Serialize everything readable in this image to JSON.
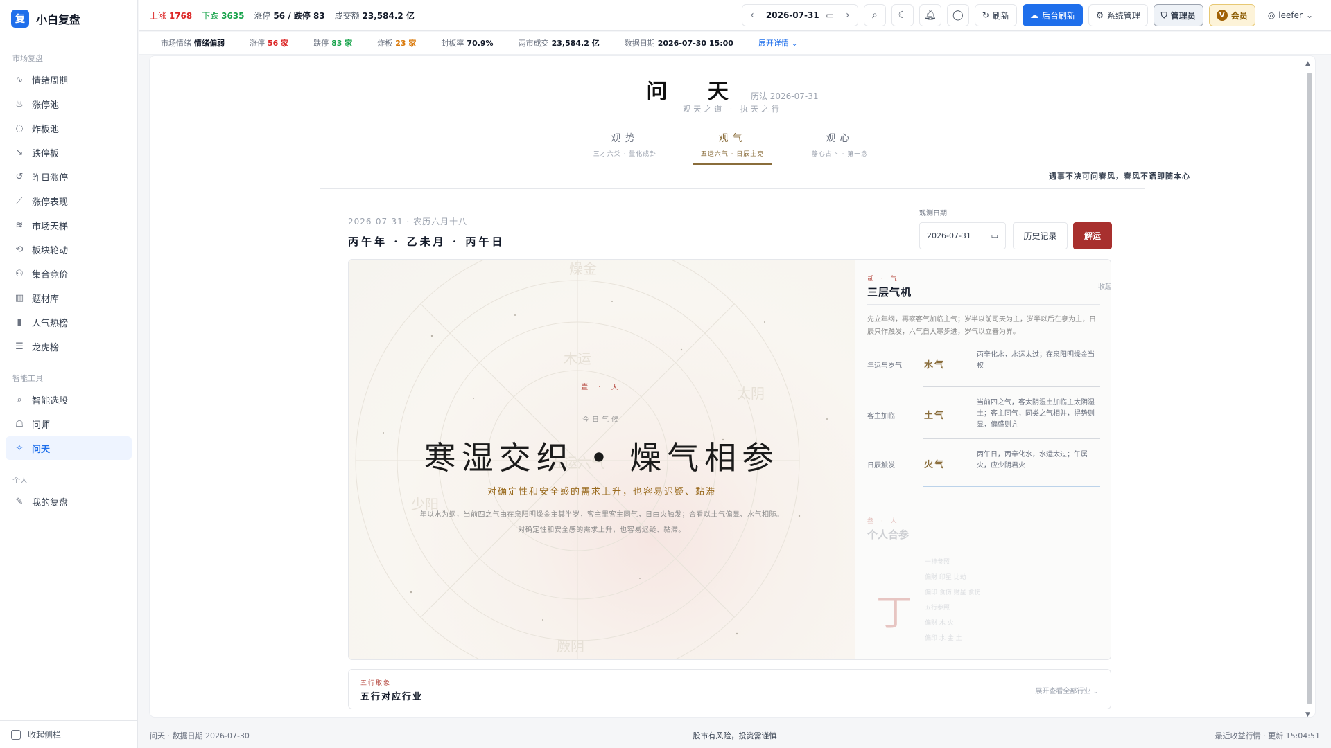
{
  "app": {
    "logo_char": "复",
    "name": "小白复盘"
  },
  "sidebar": {
    "groups": [
      {
        "label": "市场复盘",
        "items": [
          {
            "label": "情绪周期",
            "icon": "pulse-icon"
          },
          {
            "label": "涨停池",
            "icon": "flame-icon"
          },
          {
            "label": "炸板池",
            "icon": "burst-icon"
          },
          {
            "label": "跌停板",
            "icon": "trend-down-icon"
          },
          {
            "label": "昨日涨停",
            "icon": "history-icon"
          },
          {
            "label": "涨停表现",
            "icon": "chart-line-icon"
          },
          {
            "label": "市场天梯",
            "icon": "layers-icon"
          },
          {
            "label": "板块轮动",
            "icon": "rotate-icon"
          },
          {
            "label": "集合竞价",
            "icon": "auction-icon"
          },
          {
            "label": "题材库",
            "icon": "library-icon"
          },
          {
            "label": "人气热榜",
            "icon": "bar-chart-icon"
          },
          {
            "label": "龙虎榜",
            "icon": "list-icon"
          }
        ]
      },
      {
        "label": "智能工具",
        "items": [
          {
            "label": "智能选股",
            "icon": "search-icon"
          },
          {
            "label": "问师",
            "icon": "chat-icon"
          },
          {
            "label": "问天",
            "icon": "sparkle-icon",
            "active": true
          }
        ]
      },
      {
        "label": "个人",
        "items": [
          {
            "label": "我的复盘",
            "icon": "notebook-icon"
          }
        ]
      }
    ],
    "collapse_label": "收起侧栏"
  },
  "topbar": {
    "up_label": "上涨",
    "up_value": "1768",
    "down_label": "下跌",
    "down_value": "3635",
    "limit_label": "涨停",
    "limit_value": "56 / 跌停 83",
    "volume_label": "成交额",
    "volume_value": "23,584.2 亿",
    "date": "2026-07-31",
    "refresh_label": "刷新",
    "bg_refresh_label": "后台刷新",
    "sys_label": "系统管理",
    "admin_label": "管理员",
    "vip_label": "会员",
    "vip_badge": "V",
    "user_label": "leefer"
  },
  "stats": {
    "mood_label": "市场情绪",
    "mood_value": "情绪偏弱",
    "limitup_label": "涨停",
    "limitup_value": "56 家",
    "limitdown_label": "跌停",
    "limitdown_value": "83 家",
    "broken_label": "炸板",
    "broken_value": "23 家",
    "sealrate_label": "封板率",
    "sealrate_value": "70.9%",
    "turnover_label": "两市成交",
    "turnover_value": "23,584.2 亿",
    "datadate_label": "数据日期",
    "datadate_value": "2026-07-30 15:00",
    "expand_label": "展开详情"
  },
  "page": {
    "title": "问 天",
    "calendar": "历法 2026-07-31",
    "subtitle": "观天之道 · 执天之行",
    "tabs": [
      {
        "label": "观势",
        "sub": "三才六爻 · 量化成卦"
      },
      {
        "label": "观气",
        "sub": "五运六气 · 日辰主克",
        "active": true
      },
      {
        "label": "观心",
        "sub": "静心占卜 · 第一念"
      }
    ],
    "motto": "遇事不决可问春风，春风不语即随本心",
    "day_date": "2026-07-31 · 农历六月十八",
    "ganzhi": "丙午年 · 乙未月 · 丙午日",
    "obs_label": "观测日期",
    "obs_date": "2026-07-31",
    "history_label": "历史记录",
    "decode_label": "解运"
  },
  "canvas": {
    "seal": "壹 · 天",
    "today": "今日气候",
    "headline": "寒湿交织 • 燥气相参",
    "subline": "对确定性和安全感的需求上升，也容易迟疑、黏滞",
    "desc": "年以水为纲，当前四之气由在泉阳明燥金主其半岁，客主里客主同气，日由火触发；合看以土气偏显、水气相随。对确定性和安全感的需求上升，也容易迟疑、黏滞。",
    "bg_glyphs": [
      "木运",
      "五运六气",
      "燥金",
      "少阳",
      "太阴",
      "厥阴"
    ]
  },
  "panel": {
    "kicker": "贰 · 气",
    "title": "三层气机",
    "collapse": "收起",
    "intro": "先立年纲，再察客气加临主气；岁半以前司天为主，岁半以后在泉为主，日辰只作触发，六气自大寒步进，岁气以立春为界。",
    "layers": [
      {
        "name": "年运与岁气",
        "qi": "水气",
        "desc": "丙辛化水，水运太过；在泉阳明燥金当权"
      },
      {
        "name": "客主加临",
        "qi": "土气",
        "desc": "当前四之气，客太阴湿土加临主太阴湿土；客主同气，同类之气相并，得势则显，偏盛则亢"
      },
      {
        "name": "日辰触发",
        "qi": "火气",
        "desc": "丙午日，丙辛化水，水运太过；午属火，应少阴君火"
      }
    ],
    "faded": {
      "kicker": "叁 · 人",
      "title": "个人合参",
      "char": "丁",
      "grid": [
        "十神参照",
        "偏财  印星  比劫",
        "偏印  食伤  财星  食伤",
        "五行参照",
        "偏财  木  火",
        "偏印  水  金  土"
      ]
    }
  },
  "industry": {
    "kicker": "五行取象",
    "title": "五行对应行业",
    "expand": "展开查看全部行业"
  },
  "footer": {
    "left": "问天 · 数据日期 2026-07-30",
    "center": "股市有风险，投资需谨慎",
    "right": "最近收益行情 · 更新 15:04:51"
  },
  "colors": {
    "accent": "#1f6feb",
    "decode": "#a8302e",
    "gold": "#8a6d3b",
    "up": "#dc2626",
    "down": "#16a34a"
  }
}
